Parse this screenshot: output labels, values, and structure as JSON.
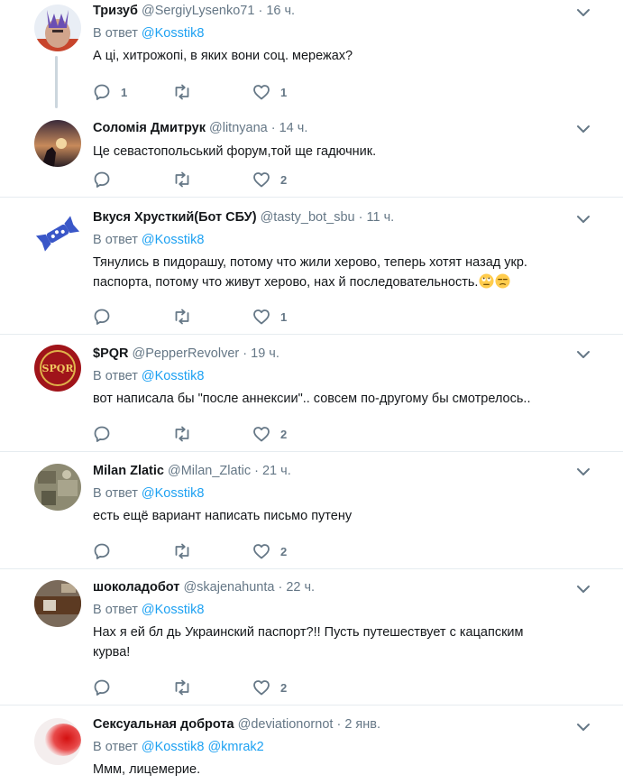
{
  "tweets": [
    {
      "name": "Тризуб",
      "handle": "@SergiyLysenko71",
      "dot": "·",
      "time": "16 ч.",
      "reply_prefix": "В ответ",
      "mentions": [
        "@Kosstik8"
      ],
      "text": "А ці, хитрожопі, в яких вони соц. мережах?",
      "replies": "1",
      "retweets": "",
      "likes": "1",
      "avatar_icon": "trident-avatar"
    },
    {
      "name": "Соломія Дмитрук",
      "handle": "@litnyana",
      "dot": "·",
      "time": "14 ч.",
      "text": "Це севастопольський форум,той ще гадючник.",
      "replies": "",
      "retweets": "",
      "likes": "2",
      "avatar_icon": "sunset-avatar"
    },
    {
      "name": "Вкуся Хрусткий(Бот СБУ)",
      "handle": "@tasty_bot_sbu",
      "dot": "·",
      "time": "11 ч.",
      "reply_prefix": "В ответ",
      "mentions": [
        "@Kosstik8"
      ],
      "text_line1": "Тянулись в пидорашу, потому что жили херово, теперь хотят назад укр.",
      "text_line2": "паспорта, потому что живут херово, нах  й последовательность.",
      "replies": "",
      "retweets": "",
      "likes": "1",
      "avatar_icon": "candy-avatar",
      "emoji": [
        "face-with-rolling-eyes",
        "unamused-face"
      ]
    },
    {
      "name": "$PQR",
      "handle": "@PepperRevolver",
      "dot": "·",
      "time": "19 ч.",
      "reply_prefix": "В ответ",
      "mentions": [
        "@Kosstik8"
      ],
      "text": "вот написала бы \"после аннексии\".. совсем по-другому бы смотрелось..",
      "replies": "",
      "retweets": "",
      "likes": "2",
      "avatar_icon": "spqr-avatar",
      "avatar_text": "SPQR"
    },
    {
      "name": "Milan Zlatic",
      "handle": "@Milan_Zlatic",
      "dot": "·",
      "time": "21 ч.",
      "reply_prefix": "В ответ",
      "mentions": [
        "@Kosstik8"
      ],
      "text": "есть ещё вариант написать письмо путену",
      "replies": "",
      "retweets": "",
      "likes": "2",
      "avatar_icon": "photo-avatar"
    },
    {
      "name": "шоколадобот",
      "handle": "@skajenahunta",
      "dot": "·",
      "time": "22 ч.",
      "reply_prefix": "В ответ",
      "mentions": [
        "@Kosstik8"
      ],
      "text_line1": "Нах  я ей бл  дь Украинский паспорт?!! Пусть путешествует с кацапским",
      "text_line2": "курва!",
      "replies": "",
      "retweets": "",
      "likes": "2",
      "avatar_icon": "chocolate-avatar"
    },
    {
      "name": "Сексуальная доброта",
      "handle": "@deviationornot",
      "dot": "·",
      "time": "2 янв.",
      "reply_prefix": "В ответ",
      "mentions": [
        "@Kosstik8",
        "@kmrak2"
      ],
      "text": "Ммм, лицемерие.",
      "avatar_icon": "red-blur-avatar"
    }
  ],
  "colors": {
    "accent": "#1da1f2",
    "muted": "#657786",
    "text": "#14171a",
    "divider": "#e6ecf0",
    "icon": "#657786"
  }
}
